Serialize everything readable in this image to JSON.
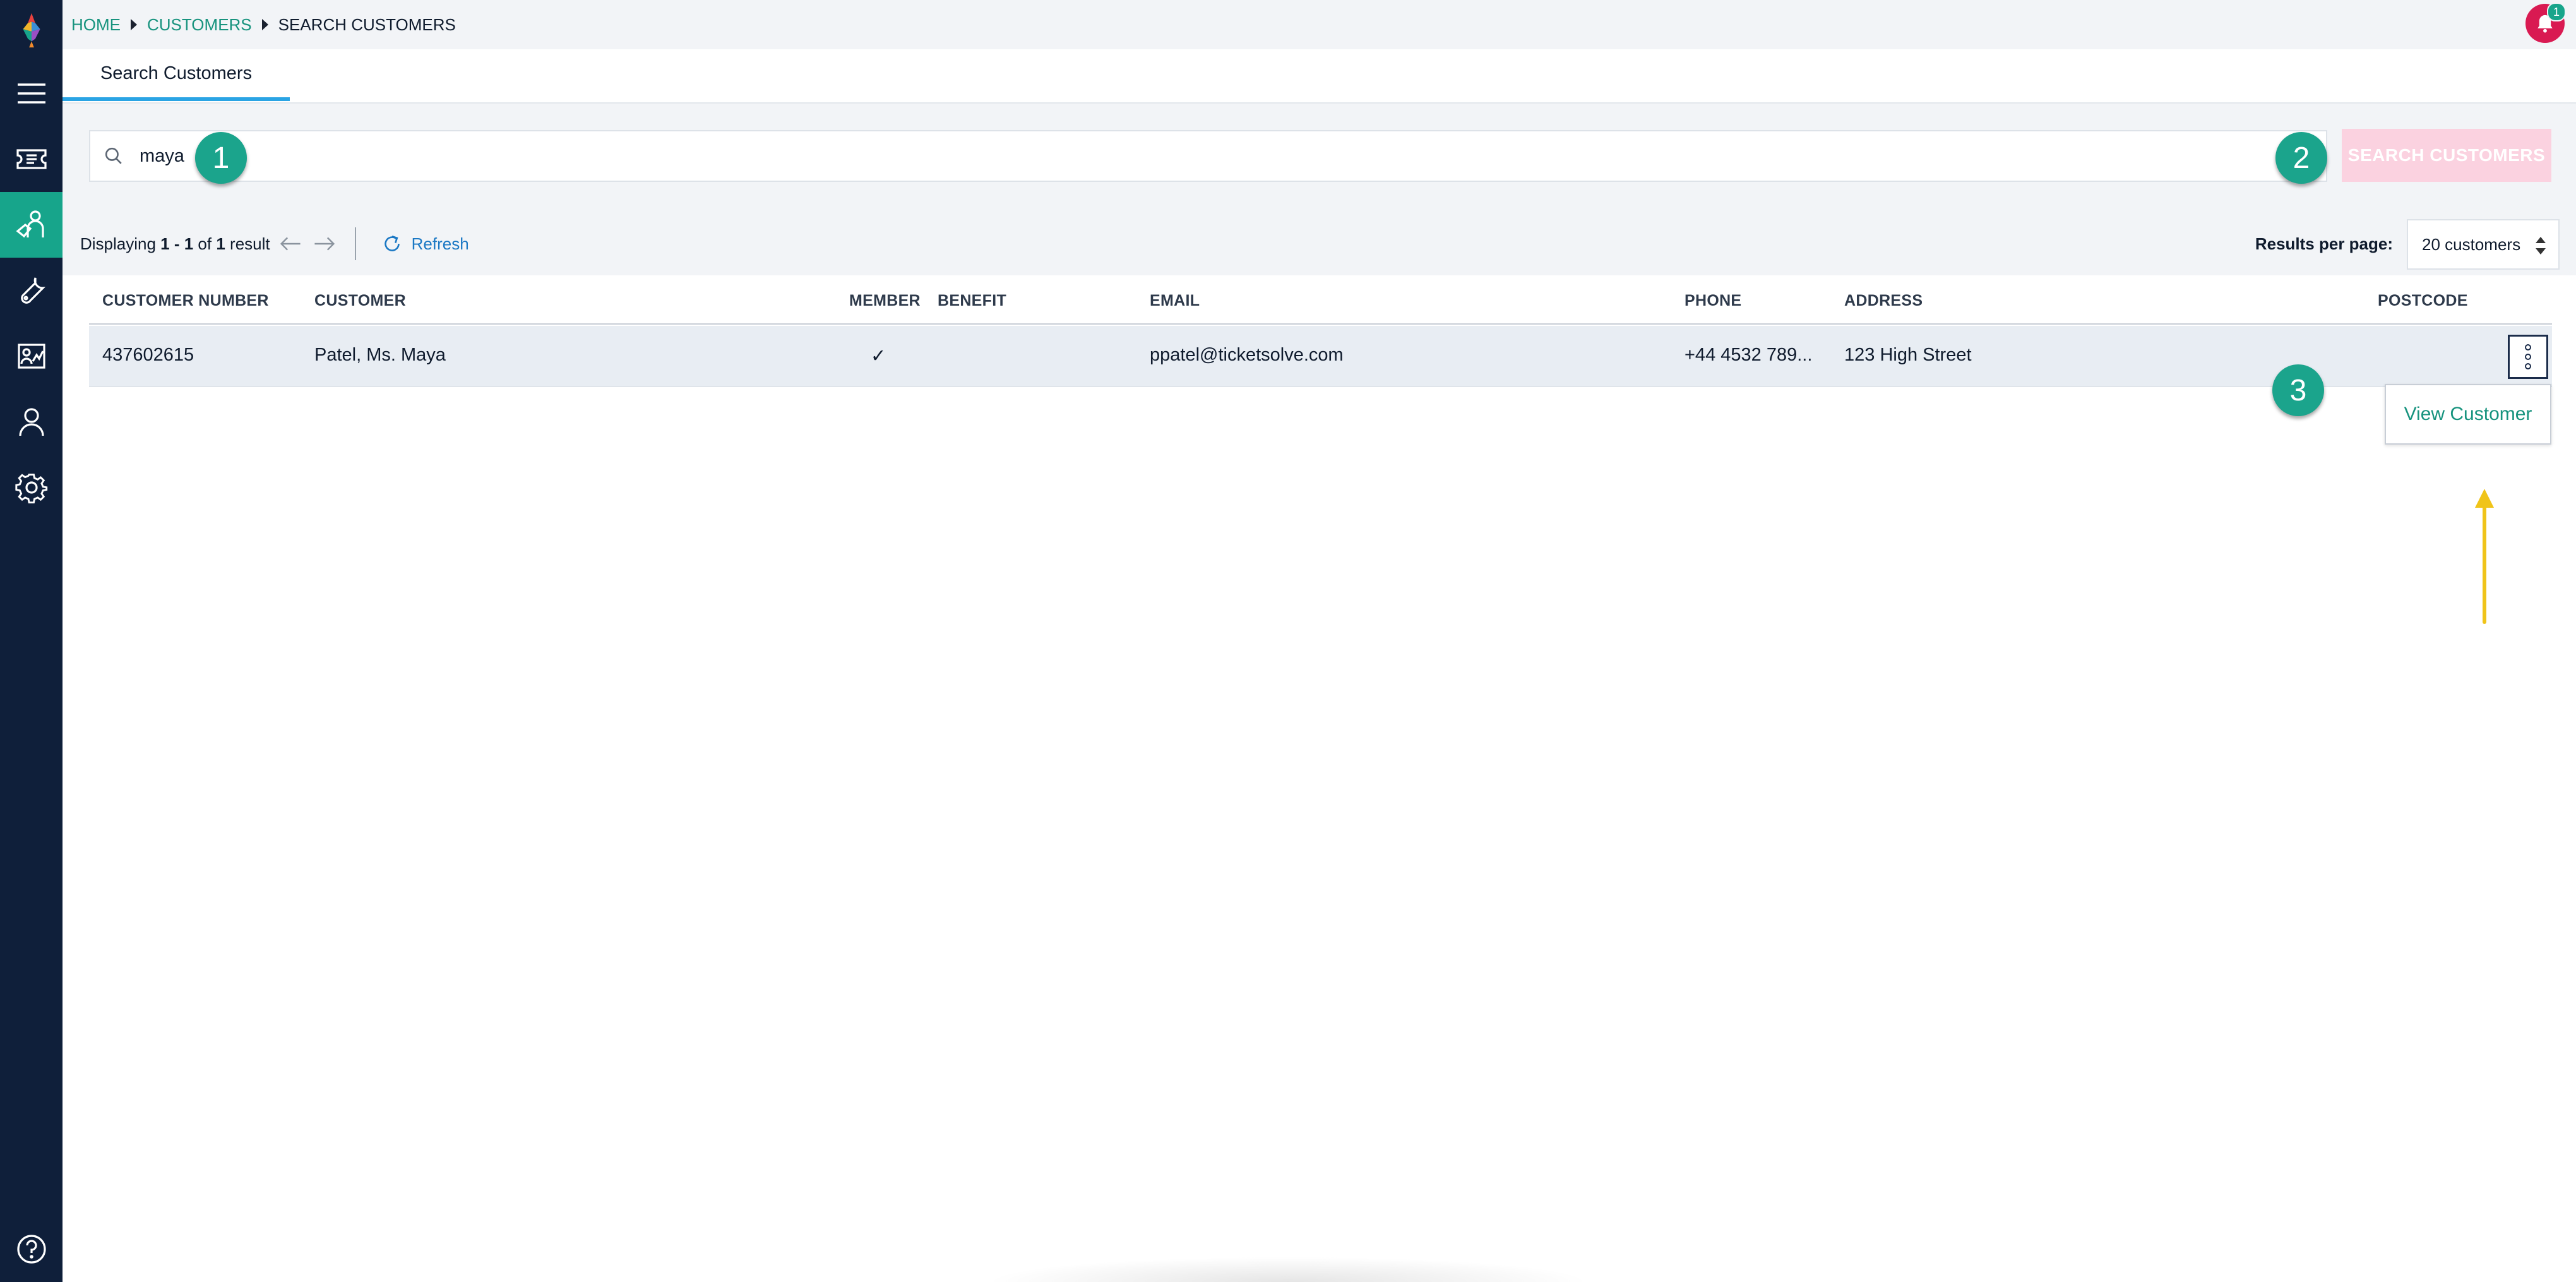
{
  "breadcrumb": {
    "home": "HOME",
    "customers": "CUSTOMERS",
    "current": "SEARCH CUSTOMERS"
  },
  "notifications": {
    "count": "1"
  },
  "tabs": [
    {
      "label": "Search Customers"
    }
  ],
  "search": {
    "value": "maya",
    "button_label": "SEARCH CUSTOMERS"
  },
  "results": {
    "prefix": "Displaying ",
    "range": "1 - 1",
    "of_text": " of ",
    "total": "1",
    "suffix": " result",
    "refresh_label": "Refresh",
    "per_page_label": "Results per page:",
    "per_page_value": "20 customers"
  },
  "table": {
    "headers": {
      "customer_number": "CUSTOMER NUMBER",
      "customer": "CUSTOMER",
      "member": "MEMBER",
      "benefit": "BENEFIT",
      "email": "EMAIL",
      "phone": "PHONE",
      "address": "ADDRESS",
      "postcode": "POSTCODE"
    },
    "rows": [
      {
        "customer_number": "437602615",
        "customer": "Patel, Ms. Maya",
        "member": "✓",
        "benefit": "",
        "email": "ppatel@ticketsolve.com",
        "phone": "+44 4532 789...",
        "address": "123 High Street",
        "postcode": ""
      }
    ]
  },
  "row_menu": {
    "view_customer": "View Customer"
  },
  "step_badges": [
    "1",
    "2",
    "3"
  ],
  "colors": {
    "sidebar": "#0f1f3a",
    "accent": "#17a58b",
    "link": "#17937e",
    "search_button_disabled": "#fbd2e0",
    "notification": "#d91a52",
    "annotation_arrow": "#f0c419"
  },
  "icons": {
    "sidebar": [
      "logo-icon",
      "menu-icon",
      "ticket-icon",
      "customers-icon",
      "tools-icon",
      "reports-icon",
      "user-icon",
      "settings-icon",
      "help-icon"
    ]
  }
}
